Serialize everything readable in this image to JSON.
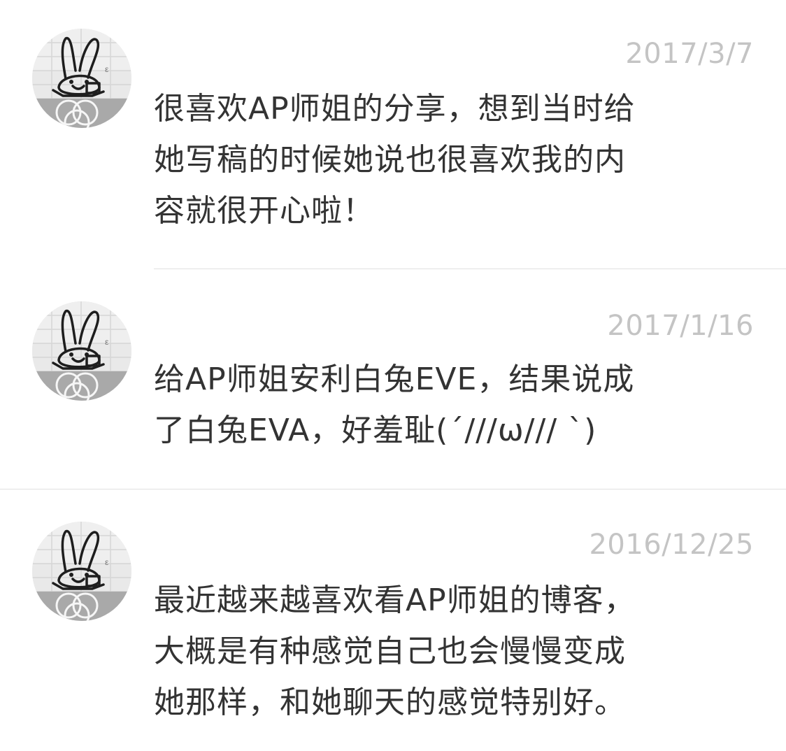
{
  "comments": [
    {
      "avatar_icon": "bunny-avatar-icon",
      "date": "2017/3/7",
      "lines": [
        "很喜欢AP师姐的分享，想到当时给",
        "她写稿的时候她说也很喜欢我的内",
        "容就很开心啦！"
      ]
    },
    {
      "avatar_icon": "bunny-avatar-icon",
      "date": "2017/1/16",
      "lines": [
        "给AP师姐安利白兔EVE，结果说成",
        "了白兔EVA，好羞耻(´///ω/// `)"
      ]
    },
    {
      "avatar_icon": "bunny-avatar-icon",
      "date": "2016/12/25",
      "lines": [
        "最近越来越喜欢看AP师姐的博客，",
        "大概是有种感觉自己也会慢慢变成",
        "她那样，和她聊天的感觉特别好。"
      ]
    }
  ],
  "colors": {
    "date_text": "#c4c4c4",
    "body_text": "#333333",
    "divider": "#e0e0e0",
    "background": "#ffffff"
  }
}
